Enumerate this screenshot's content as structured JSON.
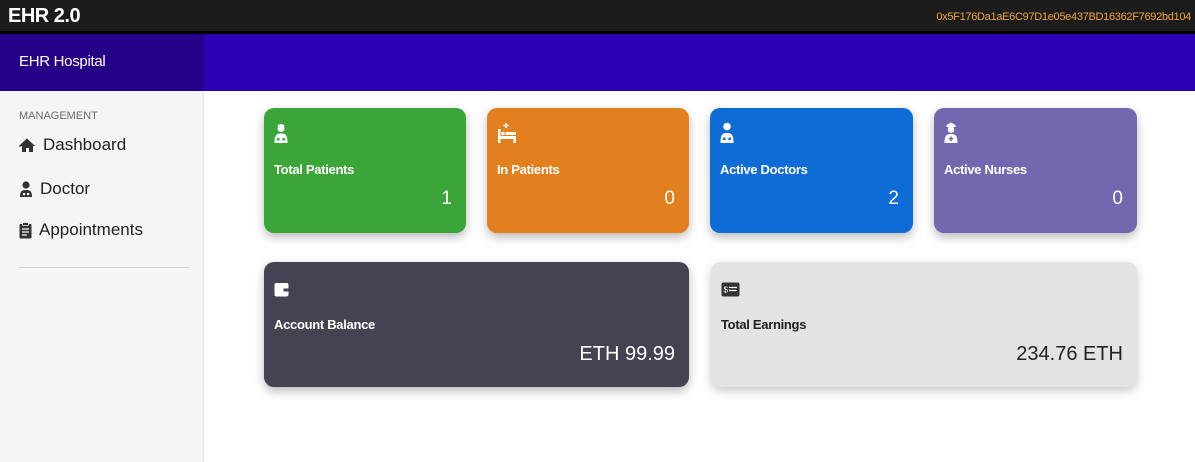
{
  "app": {
    "title": "EHR 2.0",
    "account_address": "0x5F176Da1aE6C97D1e05e437BD16362F7692bd104",
    "hospital_name": "EHR Hospital"
  },
  "sidebar": {
    "section_label": "MANAGEMENT",
    "items": [
      {
        "label": "Dashboard",
        "icon": "home-icon"
      },
      {
        "label": "Doctor",
        "icon": "doctor-icon"
      },
      {
        "label": "Appointments",
        "icon": "clipboard-icon"
      }
    ]
  },
  "stats": [
    {
      "label": "Total Patients",
      "value": "1",
      "icon": "patient-icon",
      "color": "#3ca53a"
    },
    {
      "label": "In Patients",
      "value": "0",
      "icon": "hospital-bed-icon",
      "color": "#e28020"
    },
    {
      "label": "Active Doctors",
      "value": "2",
      "icon": "doctor-icon",
      "color": "#0f6cd7"
    },
    {
      "label": "Active Nurses",
      "value": "0",
      "icon": "nurse-icon",
      "color": "#7368b0"
    }
  ],
  "summary": [
    {
      "label": "Account Balance",
      "value": "ETH 99.99",
      "icon": "wallet-icon",
      "color": "#454352"
    },
    {
      "label": "Total Earnings",
      "value": "234.76 ETH",
      "icon": "money-bill-icon",
      "color": "#e3e3e3"
    }
  ]
}
